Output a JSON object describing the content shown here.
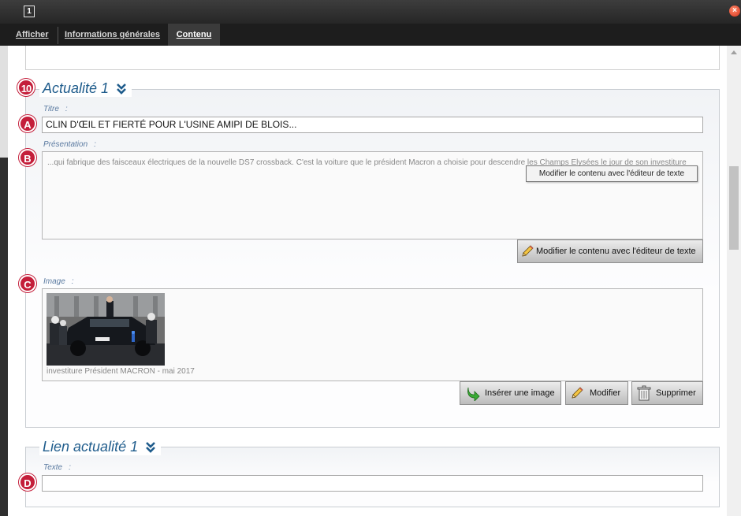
{
  "window": {
    "icon_label": "1",
    "close_label": "×"
  },
  "tabs": [
    {
      "label": "Afficher"
    },
    {
      "label": "Informations générales"
    },
    {
      "label": "Contenu"
    }
  ],
  "section1": {
    "title": "Actualité 1",
    "marker": "10",
    "titre_label": "Titre",
    "titre_value": "CLIN D'ŒIL ET FIERTÉ POUR L'USINE AMIPI DE BLOIS...",
    "presentation_label": "Présentation",
    "presentation_text": "...qui fabrique des faisceaux électriques de la nouvelle DS7 crossback. C'est la voiture que le président Macron a choisie pour descendre les Champs Elysées le jour de son investiture",
    "tooltip": "Modifier le contenu avec l'éditeur de texte",
    "edit_button": "Modifier le contenu avec l'éditeur de texte",
    "image_label": "Image",
    "image_caption": "investiture Président MACRON - mai 2017",
    "insert_button": "Insérer une image",
    "modify_button": "Modifier",
    "delete_button": "Supprimer"
  },
  "section2": {
    "title": "Lien actualité 1",
    "texte_label": "Texte",
    "texte_value": ""
  },
  "markers": {
    "a": "A",
    "b": "B",
    "c": "C",
    "d": "D"
  },
  "colon": ":"
}
